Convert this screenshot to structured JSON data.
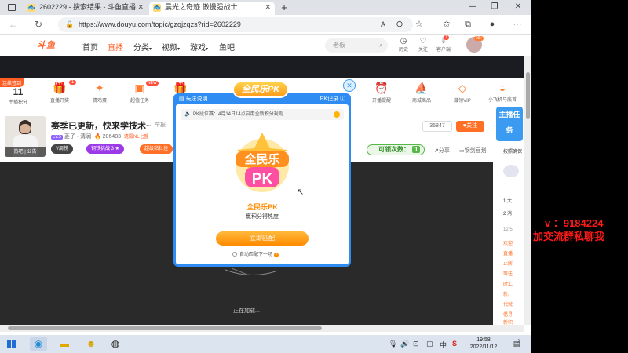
{
  "tabs": [
    {
      "label": "2602229 - 搜索结果 - 斗鱼直播",
      "icon": "douyu-tab-icon"
    },
    {
      "label": "晨光之奇迹 傲慢强战士",
      "icon": "douyu-tab-icon"
    }
  ],
  "url": "https://www.douyu.com/topic/gzqjzqzs?rid=2602229",
  "header": {
    "logo": "斗鱼",
    "nav": [
      "首页",
      "直播",
      "分类",
      "视频",
      "游戏",
      "鱼吧"
    ],
    "search_placeholder": "老板",
    "icons": [
      "历史",
      "关注",
      "客户端"
    ],
    "client_badge": "1",
    "avatar_tag": "99+"
  },
  "taskbar": {
    "signin_tag": "连续签到",
    "signin_num": "11",
    "signin_label": "主播积分",
    "tasks": [
      {
        "label": "直播开奖",
        "badge": "1"
      },
      {
        "label": "猜鸡蛋"
      },
      {
        "label": "超值任务",
        "badge": "NEW"
      },
      {
        "label": ""
      },
      {
        "label": "开播提醒"
      },
      {
        "label": "商城商品"
      },
      {
        "label": "藏领VIP"
      },
      {
        "label": "小飞机与底首"
      }
    ]
  },
  "streamer": {
    "title": "赛季已更新，快来学技术~",
    "report": "举报",
    "level": "Lv.5",
    "host": "菱子 · 清澜",
    "hot": "206483",
    "tag": "遗殿NL七盟",
    "avatar_caption": "热吧  |  公告",
    "buttons": [
      "V周榜",
      "钢铁挑战 3 ★",
      "超级粘社挂"
    ],
    "fans": "35847",
    "follow": "关注",
    "remain_label": "可领次数：",
    "remain_num": "1",
    "share": "分享",
    "client": "钢剑豆划"
  },
  "modal": {
    "rules": "玩法说明",
    "record": "PK记录",
    "badge": "全民乐PK",
    "notice": "PK段位赛：4月14日14点启用全新积分规则",
    "art_text_top": "全民乐",
    "art_text_bottom": "PK",
    "name": "全民乐PK",
    "sub": "赢积分得热度",
    "start": "立即匹配",
    "auto": "自动匹配下一场"
  },
  "video": {
    "loading": "正在加载..."
  },
  "rightcol": {
    "banner": "主播任务",
    "items": [
      "按照确保",
      "1  大",
      "2  消",
      "12:5",
      "欢迎",
      "直播",
      "止所",
      "等任",
      "时汇",
      "新。",
      "代就",
      "倡寻",
      "新积"
    ]
  },
  "overlay": {
    "line1": "v ：9184224",
    "line2": "加交流群私聊我"
  },
  "system": {
    "time": "19:58",
    "date": "2022/11/12",
    "ime": "中",
    "notif_count": "2"
  }
}
